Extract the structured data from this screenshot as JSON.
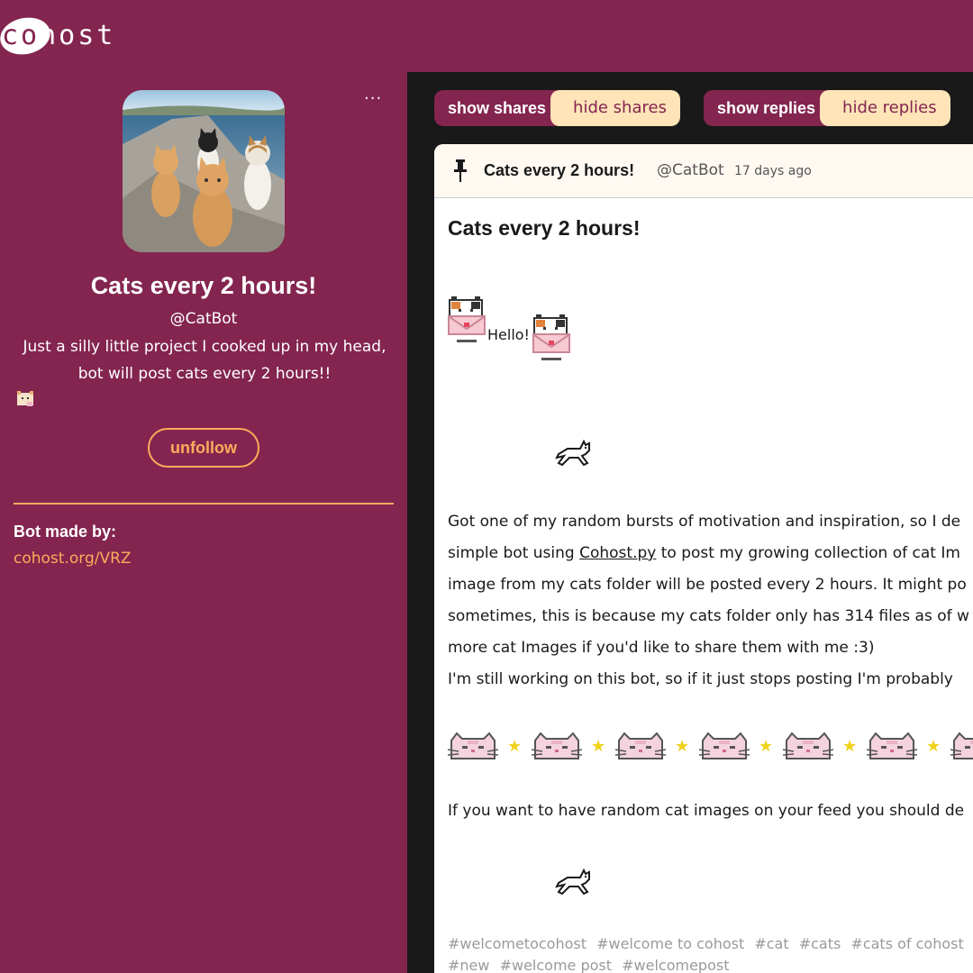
{
  "header": {
    "logo_text": "cohost",
    "logo_text_a": "co",
    "logo_text_b": "host"
  },
  "profile": {
    "more_label": "...",
    "display_name": "Cats every 2 hours!",
    "handle": "@CatBot",
    "bio": "Just a silly little project I cooked up in my head, bot will post cats every 2 hours!!",
    "unfollow_label": "unfollow",
    "made_by_label": "Bot made by:",
    "made_by_link": "cohost.org/VRZ"
  },
  "filters": {
    "show_shares": "show shares",
    "hide_shares": "hide shares",
    "show_replies": "show replies",
    "hide_replies": "hide replies"
  },
  "post": {
    "header_name": "Cats every 2 hours!",
    "header_handle": "@CatBot",
    "time_ago": "17 days ago",
    "title": "Cats every 2 hours!",
    "hello": "Hello!",
    "para_line1": "Got one of my random bursts of motivation and inspiration, so I de",
    "para_line2_a": "simple bot using ",
    "para_line2_link": "Cohost.py",
    "para_line2_b": " to post my growing collection of cat Im",
    "para_line3": "image from my cats folder will be posted every 2 hours. It might po",
    "para_line4": "sometimes, this is because my cats folder only has 314 files as of w",
    "para_line5": "more cat Images if you'd like to share them with me :3)",
    "para_line6": "I'm still working on this bot, so if it just stops posting I'm probably",
    "follow_line": "If you want to have random cat images on your feed you should de",
    "star": "★",
    "tags": [
      "#welcometocohost",
      "#welcome to cohost",
      "#cat",
      "#cats",
      "#cats of cohost",
      "#new",
      "#welcome post",
      "#welcomepost"
    ]
  },
  "colors": {
    "brand": "#83254f",
    "accent": "#ffab5c",
    "toggle_off": "#ffe4b8",
    "feed_bg": "#191919"
  },
  "icons": [
    "ellipsis-icon",
    "pin-icon",
    "cat-envelope-icon",
    "running-cat-icon",
    "cat-face-icon",
    "star-icon"
  ]
}
